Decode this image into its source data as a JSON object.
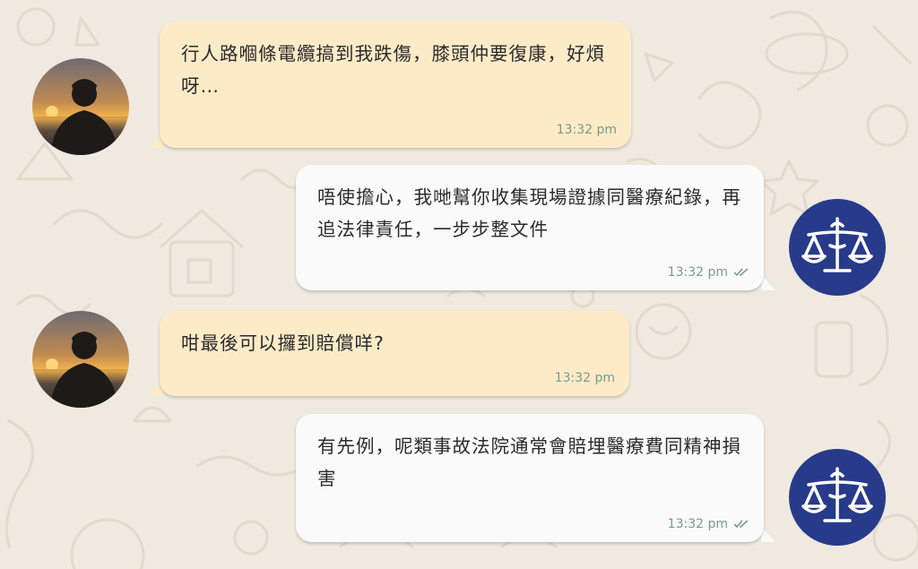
{
  "messages": [
    {
      "sender": "client",
      "text": "行人路嗰條電纜搞到我跌傷，膝頭仲要復康，好煩呀…",
      "time": "13:32 pm"
    },
    {
      "sender": "lawyer",
      "text": "唔使擔心，我哋幫你收集現場證據同醫療紀錄，再追法律責任，一步步整文件",
      "time": "13:32 pm",
      "status_icon": "double-check-icon"
    },
    {
      "sender": "client",
      "text": "咁最後可以攞到賠償咩?",
      "time": "13:32 pm"
    },
    {
      "sender": "lawyer",
      "text": "有先例，呢類事故法院通常會賠埋醫療費同精神損害",
      "time": "13:32 pm",
      "status_icon": "double-check-icon"
    }
  ],
  "colors": {
    "background": "#efe9df",
    "incoming_bubble": "#fdebc8",
    "outgoing_bubble": "#fafafa",
    "lawyer_avatar": "#283a8a",
    "timestamp": "#7a9a8c"
  },
  "icons": {
    "client_avatar": "sunset-silhouette-photo",
    "lawyer_avatar": "scales-of-justice-icon"
  }
}
